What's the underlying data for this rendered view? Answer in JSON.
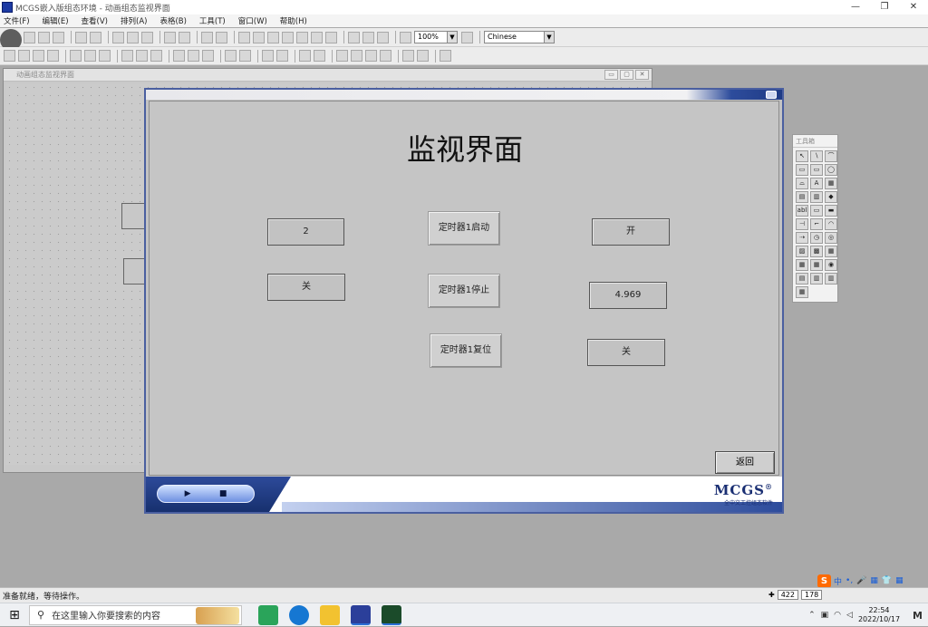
{
  "window": {
    "title": "MCGS嵌入版组态环境 - 动画组态监视界面",
    "controls": [
      "—",
      "❐",
      "✕"
    ]
  },
  "menu": [
    "文件(F)",
    "编辑(E)",
    "查看(V)",
    "排列(A)",
    "表格(B)",
    "工具(T)",
    "窗口(W)",
    "帮助(H)"
  ],
  "toolbar": {
    "zoom": "100%",
    "language": "Chinese"
  },
  "editor": {
    "title": "动画组态监视界面",
    "controls": [
      "▭",
      "▢",
      "✕"
    ]
  },
  "runtime": {
    "title": "监视界面",
    "left_display_1": "2",
    "left_display_2": "关",
    "btn_start": "定时器1启动",
    "btn_stop": "定时器1停止",
    "btn_reset": "定时器1复位",
    "right_display_1": "开",
    "right_display_2": "4.969",
    "right_display_3": "关",
    "return_label": "返回",
    "play_label": "▶",
    "stop_label": "■",
    "brand": "MCGS",
    "brand_reg": "®",
    "brand_sub": "全中文工控组态软件"
  },
  "palette": {
    "title": "工具箱",
    "tools": [
      "↖",
      "∖",
      "⌒",
      "▭",
      "▭",
      "◯",
      "⌓",
      "A",
      "▦",
      "▤",
      "▥",
      "◆",
      "abl",
      "▭",
      "▬",
      "⊣",
      "⌐",
      "◠",
      "⇢",
      "◷",
      "◎",
      "▨",
      "▩",
      "▦",
      "▦",
      "▦",
      "◉",
      "▤",
      "▥",
      "▥",
      "▦"
    ]
  },
  "status": {
    "text": "准备就绪，等待操作。",
    "x": "422",
    "y": "178"
  },
  "taskbar": {
    "search_placeholder": "在这里输入你要搜索的内容",
    "time": "22:54",
    "date": "2022/10/17"
  },
  "ime": {
    "s": "S",
    "lang": "中",
    "punct": "•,",
    "icons": [
      "🎤",
      "▦",
      "👕",
      "▦"
    ]
  }
}
